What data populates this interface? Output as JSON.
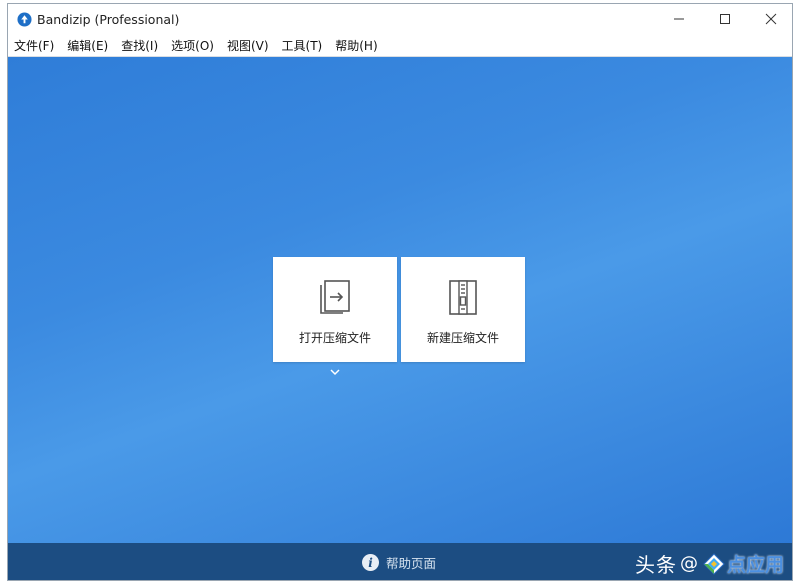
{
  "window": {
    "title": "Bandizip (Professional)",
    "controls": [
      "minimize-icon",
      "maximize-icon",
      "close-icon"
    ]
  },
  "menu": {
    "items": [
      {
        "label": "文件(F)"
      },
      {
        "label": "编辑(E)"
      },
      {
        "label": "查找(I)"
      },
      {
        "label": "选项(O)"
      },
      {
        "label": "视图(V)"
      },
      {
        "label": "工具(T)"
      },
      {
        "label": "帮助(H)"
      }
    ]
  },
  "main": {
    "open_archive": {
      "label": "打开压缩文件",
      "icon": "open-archive-icon"
    },
    "new_archive": {
      "label": "新建压缩文件",
      "icon": "new-archive-icon"
    },
    "more_icon": "chevron-down-icon"
  },
  "footer": {
    "help_label": "帮助页面",
    "help_icon": "info-icon",
    "watermark_prefix": "头条",
    "watermark_at": "@",
    "watermark_name": "点应用"
  },
  "colors": {
    "main_background": "#3b8ae0",
    "footer_background": "#1c4d82",
    "app_icon": "#1e6fc7"
  }
}
